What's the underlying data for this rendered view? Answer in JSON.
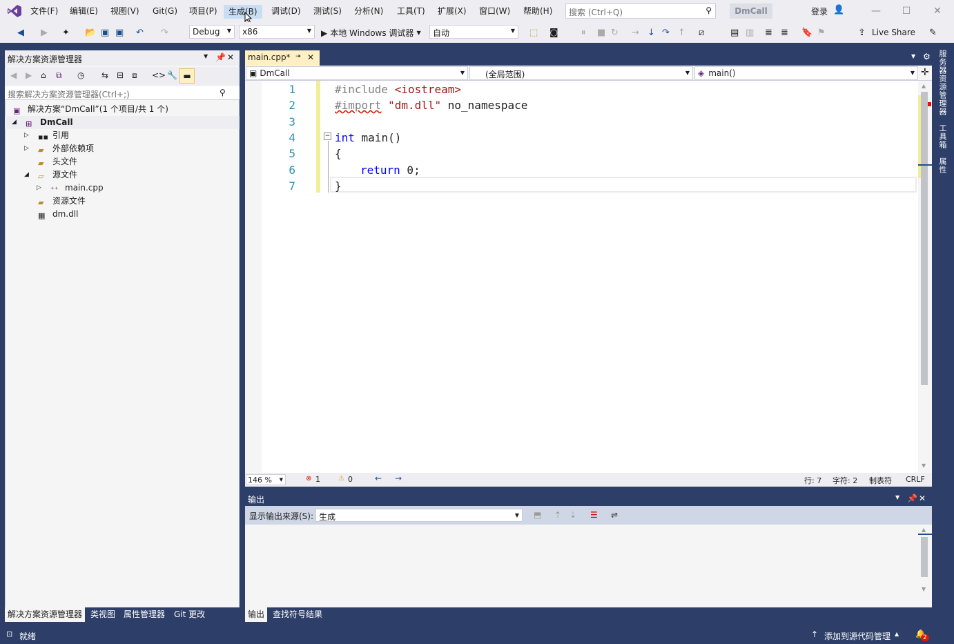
{
  "menu": [
    "文件(F)",
    "编辑(E)",
    "视图(V)",
    "Git(G)",
    "项目(P)",
    "生成(B)",
    "调试(D)",
    "测试(S)",
    "分析(N)",
    "工具(T)",
    "扩展(X)",
    "窗口(W)",
    "帮助(H)"
  ],
  "search": {
    "placeholder": "搜索 (Ctrl+Q)"
  },
  "project_badge": "DmCall",
  "signin": "登录",
  "toolbar": {
    "config": "Debug",
    "platform": "x86",
    "run_label": "本地 Windows 调试器",
    "run_mode": "自动",
    "live_share": "Live Share"
  },
  "solution_explorer": {
    "title": "解决方案资源管理器",
    "search_placeholder": "搜索解决方案资源管理器(Ctrl+;)",
    "solution": "解决方案“DmCall”(1 个项目/共 1 个)",
    "project": "DmCall",
    "items": [
      "引用",
      "外部依赖项",
      "头文件",
      "源文件",
      "main.cpp",
      "资源文件",
      "dm.dll"
    ],
    "tabs": [
      "解决方案资源管理器",
      "类视图",
      "属性管理器",
      "Git 更改"
    ]
  },
  "editor": {
    "tab": "main.cpp*",
    "nav_project": "DmCall",
    "nav_scope": "(全局范围)",
    "nav_member": "main()",
    "line_numbers": [
      "1",
      "2",
      "3",
      "4",
      "5",
      "6",
      "7"
    ],
    "code": {
      "l1a": "#include ",
      "l1b": "<iostream>",
      "l2a": "#import",
      "l2b": " \"dm.dll\"",
      "l2c": " no_namespace",
      "l4a": "int",
      "l4b": " main()",
      "l5": "{",
      "l6a": "return",
      "l6b": " 0;",
      "l7": "}"
    },
    "zoom": "146 %",
    "errors": "1",
    "warnings": "0",
    "line": "行: 7",
    "char": "字符: 2",
    "tabs": "制表符",
    "eol": "CRLF"
  },
  "output": {
    "title": "输出",
    "source_label": "显示输出来源(S):",
    "source_value": "生成",
    "tabs": [
      "输出",
      "查找符号结果"
    ]
  },
  "right_strip": [
    "服务器资源管理器",
    "工具箱",
    "属性"
  ],
  "status": {
    "ready": "就绪",
    "source_control": "添加到源代码管理",
    "notifications": "2"
  },
  "colors": {
    "accent": "#2d3e68",
    "keyword": "#0000ff",
    "string": "#a31515",
    "preproc": "#808080",
    "linenum": "#2b91af"
  }
}
